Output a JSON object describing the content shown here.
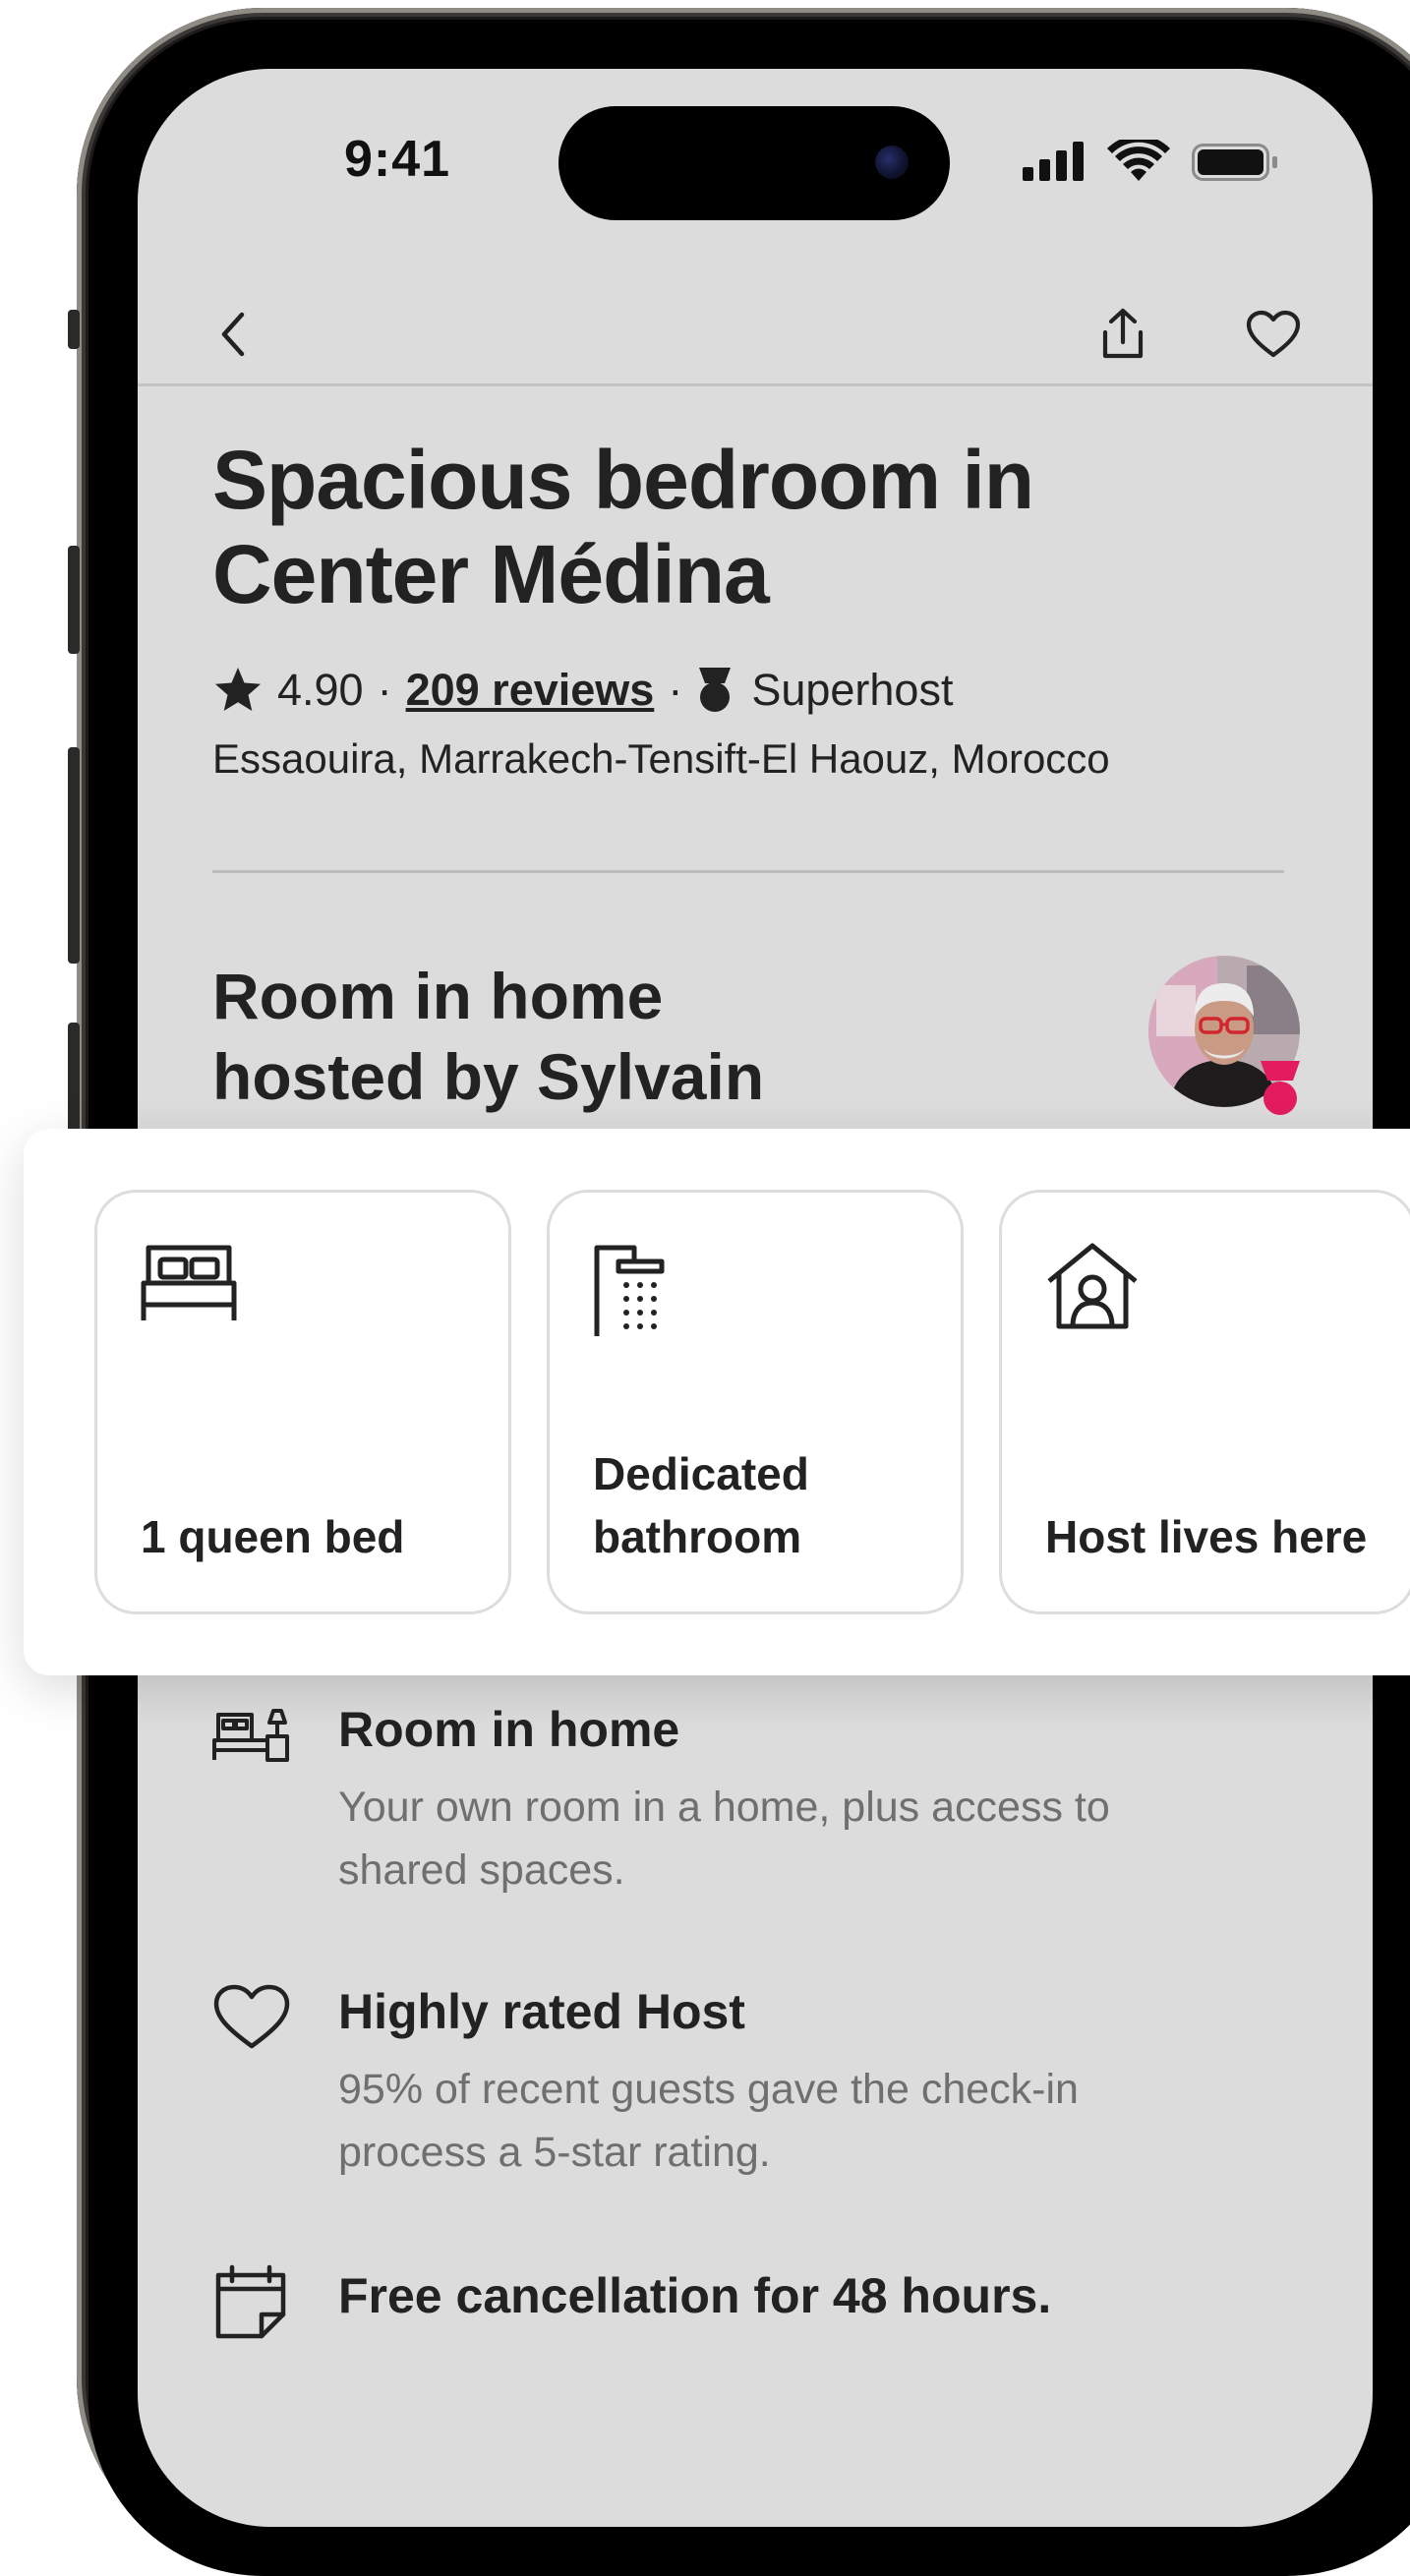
{
  "status_bar": {
    "time": "9:41"
  },
  "nav": {
    "back_icon": "chevron-left-icon",
    "share_icon": "share-icon",
    "save_icon": "heart-icon"
  },
  "listing": {
    "title_line1": "Spacious bedroom in",
    "title_line2": "Center Médina",
    "rating": "4.90",
    "reviews": "209 reviews",
    "superhost": "Superhost",
    "location": "Essaouira, Marrakech-Tensift-El Haouz, Morocco"
  },
  "host": {
    "heading_line1": "Room in home",
    "heading_line2": "hosted by Sylvain"
  },
  "highlights": [
    {
      "icon": "bed-icon",
      "label": "1 queen bed"
    },
    {
      "icon": "shower-icon",
      "label": "Dedicated bathroom"
    },
    {
      "icon": "house-person-icon",
      "label": "Host lives here"
    }
  ],
  "features": [
    {
      "icon": "room-icon",
      "title": "Room in home",
      "description": "Your own room in a home, plus access to shared spaces."
    },
    {
      "icon": "heart-icon",
      "title": "Highly rated Host",
      "description": "95% of recent guests gave the check-in process a 5-star rating."
    },
    {
      "icon": "calendar-icon",
      "title": "Free cancellation for 48 hours.",
      "description": ""
    }
  ],
  "colors": {
    "screen_background": "#dcdcdc",
    "card_background": "#ffffff",
    "text_primary": "#222222",
    "text_secondary": "#6f6f6f",
    "superhost_badge": "#e31c5f"
  }
}
